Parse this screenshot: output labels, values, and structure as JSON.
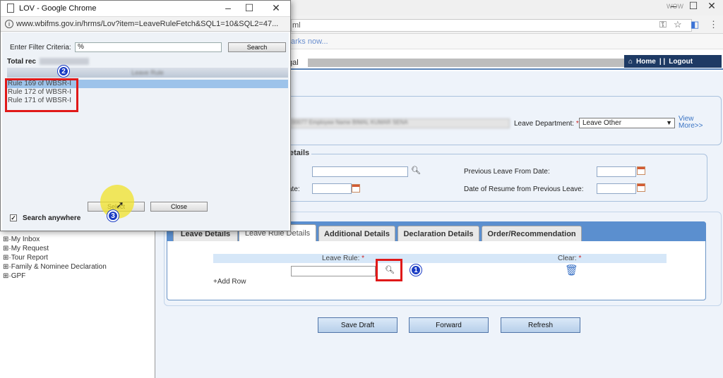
{
  "browser": {
    "user_badge": "WOW",
    "url_tail": "ml",
    "bookmarks_text": "arks now..."
  },
  "header": {
    "title_fragment": "gal",
    "nav_home": "Home",
    "nav_logout": "Logout"
  },
  "employee_section": {
    "employee_info_blurred": "00077 Employee Name BIMAL KUMAR SENA",
    "leave_department_label": "Leave Department:",
    "leave_department_value": "Leave Other",
    "view_more": "View More>>"
  },
  "details_section": {
    "legend_fragment": "etails",
    "date_label_fragment": "ate:",
    "previous_leave_from_label": "Previous Leave From Date:",
    "resume_label": "Date of Resume from Previous Leave:"
  },
  "tabs": [
    {
      "label": "Leave Details"
    },
    {
      "label": "Leave Rule Details"
    },
    {
      "label": "Additional Details"
    },
    {
      "label": "Declaration Details"
    },
    {
      "label": "Order/Recommendation"
    }
  ],
  "leave_rule_grid": {
    "leave_rule_label": "Leave Rule:",
    "clear_label": "Clear:",
    "required_mark": "*",
    "add_row": "+Add Row"
  },
  "actions": {
    "save_draft": "Save Draft",
    "forward": "Forward",
    "refresh": "Refresh"
  },
  "sidebar": {
    "items": [
      {
        "label": "My Inbox"
      },
      {
        "label": "My Request"
      },
      {
        "label": "Tour Report"
      },
      {
        "label": "Family & Nominee Declaration"
      },
      {
        "label": "GPF"
      }
    ]
  },
  "popup": {
    "title": "LOV - Google Chrome",
    "url": "www.wbifms.gov.in/hrms/Lov?item=LeaveRuleFetch&SQL1=10&SQL2=47...",
    "filter_label": "Enter Filter Criteria:",
    "filter_value": "%",
    "search_button": "Search",
    "total_records_label": "Total rec",
    "list_header": "Leave Rule",
    "rows": [
      {
        "label": "Rule 169 of WBSR-I",
        "selected": true
      },
      {
        "label": "Rule 172 of WBSR-I",
        "selected": false
      },
      {
        "label": "Rule 171 of WBSR-I",
        "selected": false
      }
    ],
    "select_button": "Select",
    "close_button": "Close",
    "search_anywhere": "Search anywhere"
  },
  "annotations": {
    "step1": "1",
    "step2": "2",
    "step3": "3",
    "accent_color": "#e01919",
    "badge_color": "#1a3cc4"
  }
}
